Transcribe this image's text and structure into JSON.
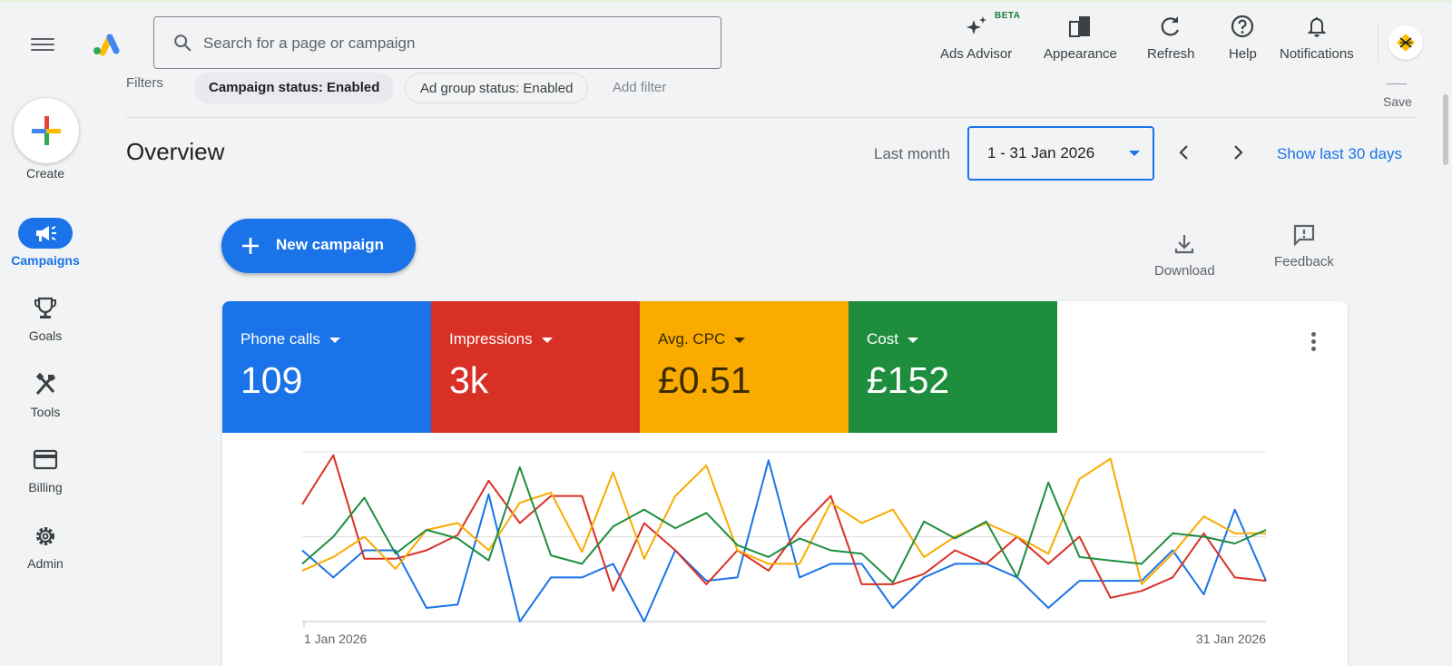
{
  "header": {
    "search_placeholder": "Search for a page or campaign",
    "buttons": [
      {
        "label": "Ads Advisor",
        "icon": "sparkle-icon"
      },
      {
        "label": "Appearance",
        "icon": "appearance-icon"
      },
      {
        "label": "Refresh",
        "icon": "refresh-icon"
      },
      {
        "label": "Help",
        "icon": "help-icon"
      },
      {
        "label": "Notifications",
        "icon": "bell-icon"
      }
    ],
    "beta_badge": "BETA"
  },
  "filters": {
    "label": "Filters",
    "chips": [
      "Campaign status: Enabled",
      "Ad group status: Enabled"
    ],
    "add_filter": "Add filter",
    "save": "Save"
  },
  "sidebar": {
    "create_label": "Create",
    "items": [
      {
        "label": "Campaigns",
        "icon": "megaphone-icon",
        "active": true
      },
      {
        "label": "Goals",
        "icon": "trophy-icon"
      },
      {
        "label": "Tools",
        "icon": "tools-icon"
      },
      {
        "label": "Billing",
        "icon": "credit-card-icon"
      },
      {
        "label": "Admin",
        "icon": "gear-icon"
      }
    ]
  },
  "overview": {
    "title": "Overview",
    "period_label": "Last month",
    "date_range": "1 - 31 Jan 2026",
    "show_last": "Show last 30 days",
    "new_campaign": "New campaign",
    "download": "Download",
    "feedback": "Feedback"
  },
  "metrics": [
    {
      "name": "Phone calls",
      "value": "109",
      "color": "#1a73e8"
    },
    {
      "name": "Impressions",
      "value": "3k",
      "color": "#d93025"
    },
    {
      "name": "Avg. CPC",
      "value": "£0.51",
      "color": "#f9ab00"
    },
    {
      "name": "Cost",
      "value": "£152",
      "color": "#1e8e3e"
    }
  ],
  "chart_data": {
    "type": "line",
    "x_start_label": "1 Jan 2026",
    "x_end_label": "31 Jan 2026",
    "ylim": [
      0,
      100
    ],
    "grid": true,
    "series": [
      {
        "color": "#1a73e8",
        "values": [
          42,
          26,
          42,
          42,
          8,
          10,
          75,
          0,
          26,
          26,
          34,
          0,
          42,
          24,
          26,
          95,
          26,
          34,
          34,
          8,
          26,
          34,
          34,
          26,
          8,
          24,
          24,
          24,
          42,
          16,
          66,
          24
        ]
      },
      {
        "color": "#d93025",
        "values": [
          69,
          98,
          37,
          37,
          42,
          51,
          83,
          58,
          74,
          74,
          18,
          58,
          42,
          22,
          42,
          30,
          55,
          74,
          22,
          22,
          28,
          42,
          34,
          50,
          34,
          50,
          14,
          18,
          26,
          52,
          26,
          24
        ]
      },
      {
        "color": "#f9ab00",
        "values": [
          30,
          38,
          50,
          31,
          54,
          58,
          42,
          70,
          76,
          41,
          88,
          37,
          74,
          92,
          42,
          34,
          34,
          70,
          58,
          66,
          38,
          50,
          58,
          50,
          40,
          84,
          96,
          22,
          40,
          62,
          52,
          52
        ]
      },
      {
        "color": "#1e8e3e",
        "values": [
          34,
          50,
          73,
          40,
          54,
          49,
          36,
          91,
          39,
          34,
          56,
          66,
          55,
          64,
          45,
          38,
          49,
          42,
          40,
          23,
          59,
          49,
          59,
          26,
          82,
          38,
          36,
          34,
          52,
          50,
          46,
          54
        ]
      }
    ]
  }
}
